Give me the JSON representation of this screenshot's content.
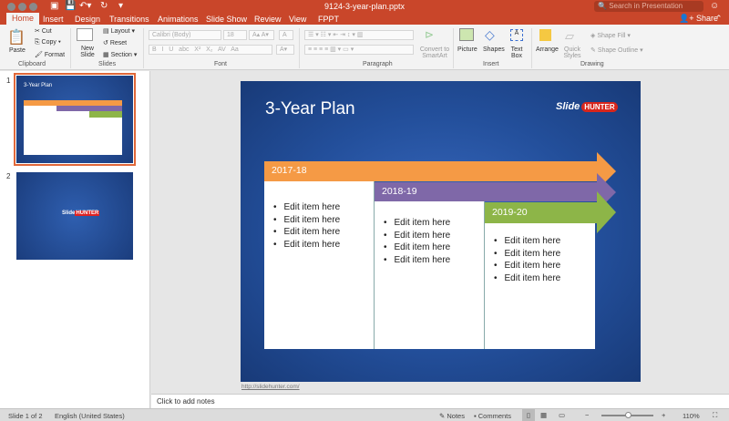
{
  "app": {
    "doc_title": "9124-3-year-plan.pptx",
    "search_placeholder": "Search in Presentation",
    "share": "Share"
  },
  "tabs": [
    "Home",
    "Insert",
    "Design",
    "Transitions",
    "Animations",
    "Slide Show",
    "Review",
    "View",
    "FPPT"
  ],
  "ribbon": {
    "clipboard": {
      "paste": "Paste",
      "cut": "Cut",
      "copy": "Copy",
      "format": "Format",
      "label": "Clipboard"
    },
    "slides": {
      "new_slide": "New Slide",
      "layout": "Layout",
      "reset": "Reset",
      "section": "Section",
      "label": "Slides"
    },
    "font": {
      "font_name": "Calibri (Body)",
      "font_size": "18",
      "label": "Font"
    },
    "paragraph": {
      "convert": "Convert to SmartArt",
      "label": "Paragraph"
    },
    "insert": {
      "picture": "Picture",
      "shapes": "Shapes",
      "textbox": "Text Box",
      "label": "Insert"
    },
    "drawing": {
      "arrange": "Arrange",
      "quick_styles": "Quick Styles",
      "shape_fill": "Shape Fill",
      "shape_outline": "Shape Outline",
      "label": "Drawing"
    }
  },
  "thumbnails": [
    {
      "number": "1"
    },
    {
      "number": "2"
    }
  ],
  "slide": {
    "title": "3-Year Plan",
    "logo": "SlideHUNTER",
    "phases": [
      {
        "label": "2017-18",
        "color": "#f59a45",
        "items": [
          "Edit item here",
          "Edit item here",
          "Edit item here",
          "Edit item here"
        ]
      },
      {
        "label": "2018-19",
        "color": "#7f68a8",
        "items": [
          "Edit item here",
          "Edit item here",
          "Edit item here",
          "Edit item here"
        ]
      },
      {
        "label": "2019-20",
        "color": "#8db548",
        "items": [
          "Edit item here",
          "Edit item here",
          "Edit item here",
          "Edit item here"
        ]
      }
    ],
    "footer_link": "http://slidehunter.com/"
  },
  "notes_placeholder": "Click to add notes",
  "status": {
    "slide": "Slide 1 of 2",
    "language": "English (United States)",
    "notes": "Notes",
    "comments": "Comments",
    "zoom": "110%",
    "zoom_level": 110
  }
}
